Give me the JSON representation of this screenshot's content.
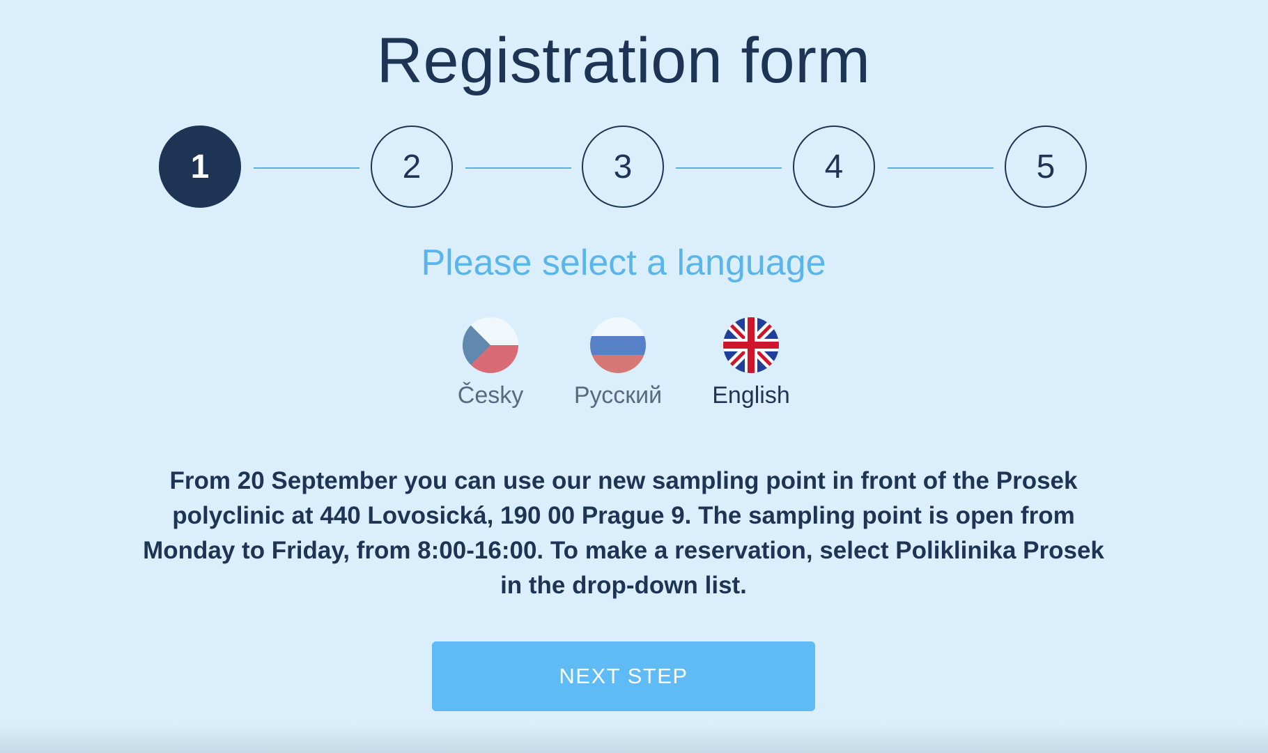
{
  "page": {
    "title": "Registration form",
    "subtitle": "Please select a language"
  },
  "stepper": {
    "current_step": 1,
    "steps": [
      {
        "label": "1",
        "state": "active"
      },
      {
        "label": "2",
        "state": "inactive"
      },
      {
        "label": "3",
        "state": "inactive"
      },
      {
        "label": "4",
        "state": "inactive"
      },
      {
        "label": "5",
        "state": "inactive"
      }
    ]
  },
  "languages": {
    "selected": "English",
    "items": [
      {
        "label": "Česky",
        "icon": "czech-flag-icon",
        "selected": false
      },
      {
        "label": "Русский",
        "icon": "russian-flag-icon",
        "selected": false
      },
      {
        "label": "English",
        "icon": "uk-flag-icon",
        "selected": true
      }
    ]
  },
  "notice": {
    "text": "From 20 September you can use our new sampling point in front of the Prosek polyclinic at 440 Lovosická, 190 00 Prague 9. The sampling point is open from Monday to Friday, from 8:00-16:00. To make a reservation, select Poliklinika Prosek in the drop-down list."
  },
  "actions": {
    "next_label": "NEXT STEP"
  },
  "colors": {
    "background": "#daeffb",
    "primary_dark": "#1e3454",
    "accent_light_blue": "#5ab5ea",
    "button_blue": "#5ebbf5",
    "connector_line": "#5aaedc"
  }
}
